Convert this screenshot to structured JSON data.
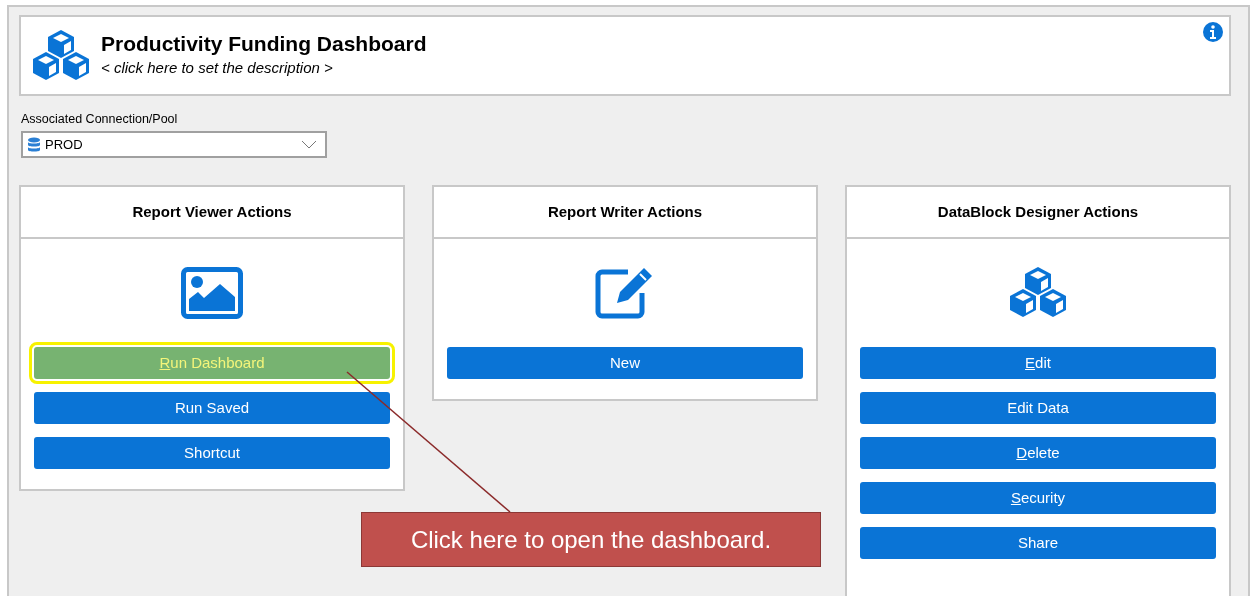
{
  "header": {
    "title": "Productivity Funding Dashboard",
    "description": "< click here to set the description >"
  },
  "connection": {
    "label": "Associated Connection/Pool",
    "value": "PROD"
  },
  "panels": [
    {
      "title": "Report Viewer Actions",
      "kind": "image",
      "buttons": [
        {
          "label": "Run Dashboard",
          "underline_first": true,
          "highlighted": true
        },
        {
          "label": "Run Saved",
          "underline_first": false,
          "highlighted": false
        },
        {
          "label": "Shortcut",
          "underline_first": false,
          "highlighted": false
        }
      ]
    },
    {
      "title": "Report Writer Actions",
      "kind": "edit",
      "buttons": [
        {
          "label": "New",
          "underline_first": false,
          "highlighted": false
        }
      ]
    },
    {
      "title": "DataBlock Designer Actions",
      "kind": "cubes",
      "buttons": [
        {
          "label": "Edit",
          "underline_first": true,
          "highlighted": false
        },
        {
          "label": "Edit Data",
          "underline_first": false,
          "highlighted": false
        },
        {
          "label": "Delete",
          "underline_first": true,
          "highlighted": false
        },
        {
          "label": "Security",
          "underline_first": true,
          "highlighted": false
        },
        {
          "label": "Share",
          "underline_first": false,
          "highlighted": false
        }
      ]
    }
  ],
  "callout": {
    "text": "Click here to open the dashboard."
  }
}
